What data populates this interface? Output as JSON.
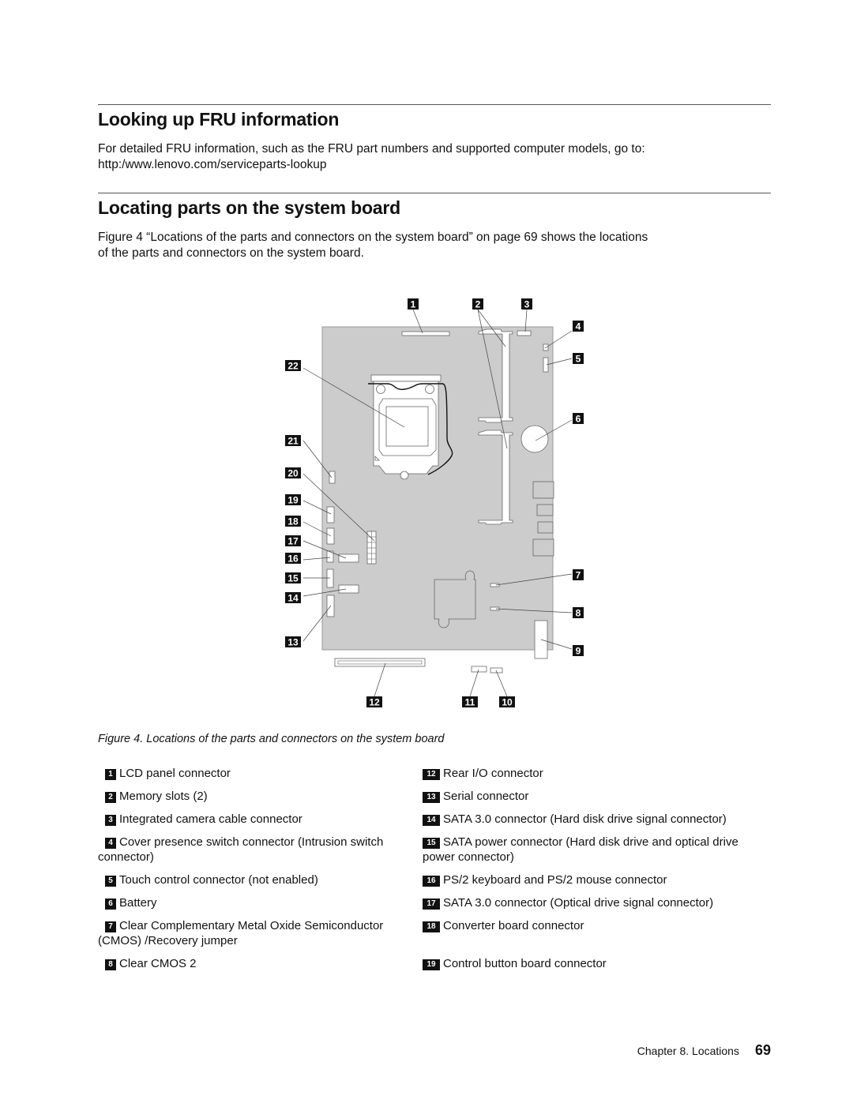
{
  "sections": [
    {
      "heading": "Looking up FRU information",
      "body_lines": [
        "For detailed FRU information, such as the FRU part numbers and supported computer models, go to:",
        "http:/www.lenovo.com/serviceparts-lookup"
      ]
    },
    {
      "heading": "Locating parts on the system board",
      "body_lines": [
        "Figure 4 “Locations of the parts and connectors on the system board” on page 69 shows the locations",
        "of the parts and connectors on the system board."
      ]
    }
  ],
  "figure": {
    "callouts": [
      "1",
      "2",
      "3",
      "4",
      "5",
      "6",
      "7",
      "8",
      "9",
      "10",
      "11",
      "12",
      "13",
      "14",
      "15",
      "16",
      "17",
      "18",
      "19",
      "20",
      "21",
      "22"
    ],
    "caption": "Figure 4.  Locations of the parts and connectors on the system board",
    "colors": {
      "board": "#cccccc",
      "badge": "#111111",
      "outline": "#666666"
    }
  },
  "legend": {
    "left": [
      {
        "num": "1",
        "text": "LCD panel connector"
      },
      {
        "num": "2",
        "text": "Memory slots (2)"
      },
      {
        "num": "3",
        "text": "Integrated camera cable connector"
      },
      {
        "num": "4",
        "text": "Cover presence switch connector (Intrusion switch connector)"
      },
      {
        "num": "5",
        "text": "Touch control connector (not enabled)"
      },
      {
        "num": "6",
        "text": "Battery"
      },
      {
        "num": "7",
        "text": "Clear Complementary Metal Oxide Semiconductor (CMOS) /Recovery jumper"
      },
      {
        "num": "8",
        "text": "Clear CMOS 2"
      }
    ],
    "right": [
      {
        "num": "12",
        "text": "Rear I/O connector"
      },
      {
        "num": "13",
        "text": "Serial connector"
      },
      {
        "num": "14",
        "text": "SATA 3.0 connector (Hard disk drive signal connector)"
      },
      {
        "num": "15",
        "text": "SATA power connector (Hard disk drive and optical drive power connector)"
      },
      {
        "num": "16",
        "text": "PS/2 keyboard and PS/2 mouse connector"
      },
      {
        "num": "17",
        "text": "SATA 3.0 connector (Optical drive signal connector)"
      },
      {
        "num": "18",
        "text": "Converter board connector"
      },
      {
        "num": "19",
        "text": "Control button board connector"
      }
    ]
  },
  "footer": {
    "chapter": "Chapter 8.  Locations",
    "page": "69"
  }
}
